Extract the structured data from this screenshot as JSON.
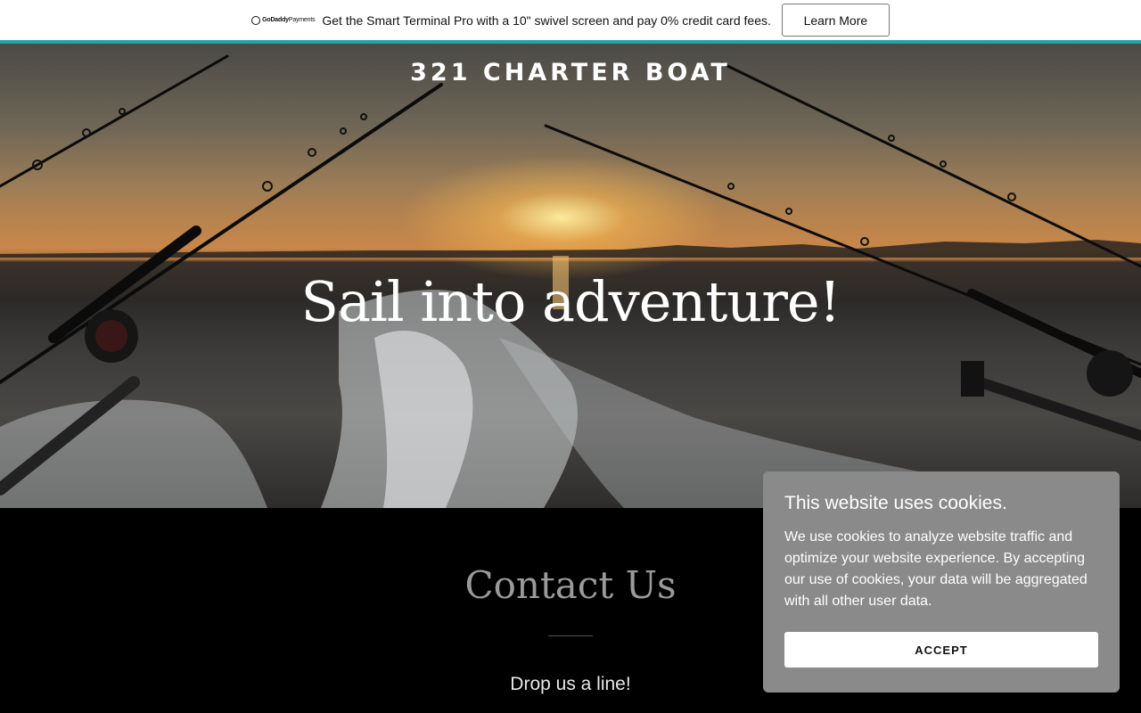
{
  "promo": {
    "logo_brand": "GoDaddy",
    "logo_product": "Payments",
    "text": "Get the Smart Terminal Pro with a 10\" swivel screen and pay 0% credit card fees.",
    "button_label": "Learn More",
    "accent_color": "#1fa5a7"
  },
  "hero": {
    "site_title": "321 CHARTER BOAT",
    "headline": "Sail into adventure!"
  },
  "contact": {
    "title": "Contact Us",
    "subtitle": "Drop us a line!"
  },
  "cookie_banner": {
    "title": "This website uses cookies.",
    "body": "We use cookies to analyze website traffic and optimize your website experience. By accepting our use of cookies, your data will be aggregated with all other user data.",
    "accept_label": "ACCEPT"
  }
}
